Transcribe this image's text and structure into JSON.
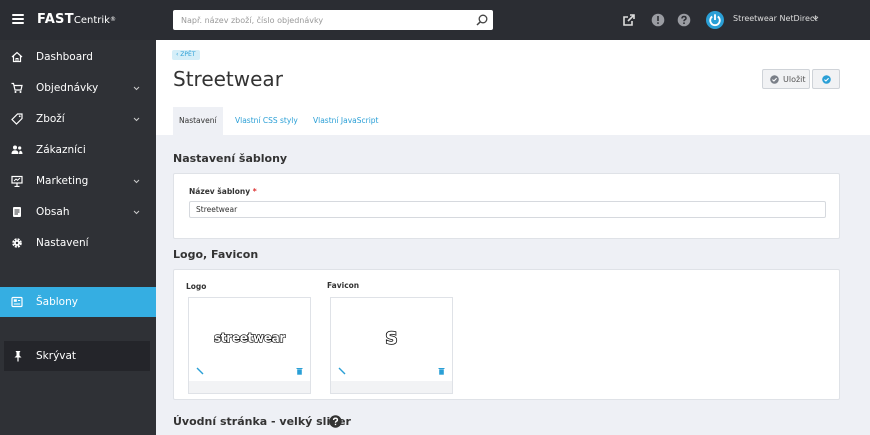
{
  "topbar": {
    "logo_bold": "FAST",
    "logo_light": "Centrik",
    "logo_mark": "®",
    "search_placeholder": "Např. název zboží, číslo objednávky",
    "user_name": "Streetwear NetDirect",
    "icons": [
      "hamburger-icon",
      "search-icon",
      "external-link-icon",
      "info-icon",
      "help-icon",
      "power-icon",
      "chevron-down-icon"
    ]
  },
  "sidebar": {
    "items": [
      {
        "label": "Dashboard",
        "icon": "home-icon",
        "has_submenu": false
      },
      {
        "label": "Objednávky",
        "icon": "cart-icon",
        "has_submenu": true
      },
      {
        "label": "Zboží",
        "icon": "tag-icon",
        "has_submenu": true
      },
      {
        "label": "Zákazníci",
        "icon": "users-icon",
        "has_submenu": false
      },
      {
        "label": "Marketing",
        "icon": "presentation-icon",
        "has_submenu": true
      },
      {
        "label": "Obsah",
        "icon": "document-icon",
        "has_submenu": true
      },
      {
        "label": "Nastavení",
        "icon": "gear-icon",
        "has_submenu": false
      }
    ],
    "active_item": {
      "label": "Šablony",
      "icon": "template-icon"
    },
    "pin": {
      "label": "Skrývat",
      "icon": "pin-icon"
    }
  },
  "header": {
    "back_label": "‹ ZPĚT",
    "title": "Streetwear",
    "save_label": "Uložit",
    "tabs": [
      {
        "label": "Nastavení",
        "active": true
      },
      {
        "label": "Vlastní CSS styly",
        "active": false
      },
      {
        "label": "Vlastní JavaScript",
        "active": false
      }
    ]
  },
  "sections": {
    "template_settings": {
      "title": "Nastavení šablony",
      "name_label": "Název šablony",
      "required_mark": "*",
      "name_value": "Streetwear"
    },
    "logo_favicon": {
      "title": "Logo, Favicon",
      "logo_label": "Logo",
      "logo_image_text": "streetwear",
      "favicon_label": "Favicon",
      "favicon_image_text": "S"
    },
    "slider": {
      "title": "Úvodní stránka - velký slider"
    }
  },
  "colors": {
    "accent": "#35aee2",
    "sidebar_bg": "#2f3136",
    "topbar_bg": "#2b2d33",
    "content_bg": "#eef0f5"
  }
}
